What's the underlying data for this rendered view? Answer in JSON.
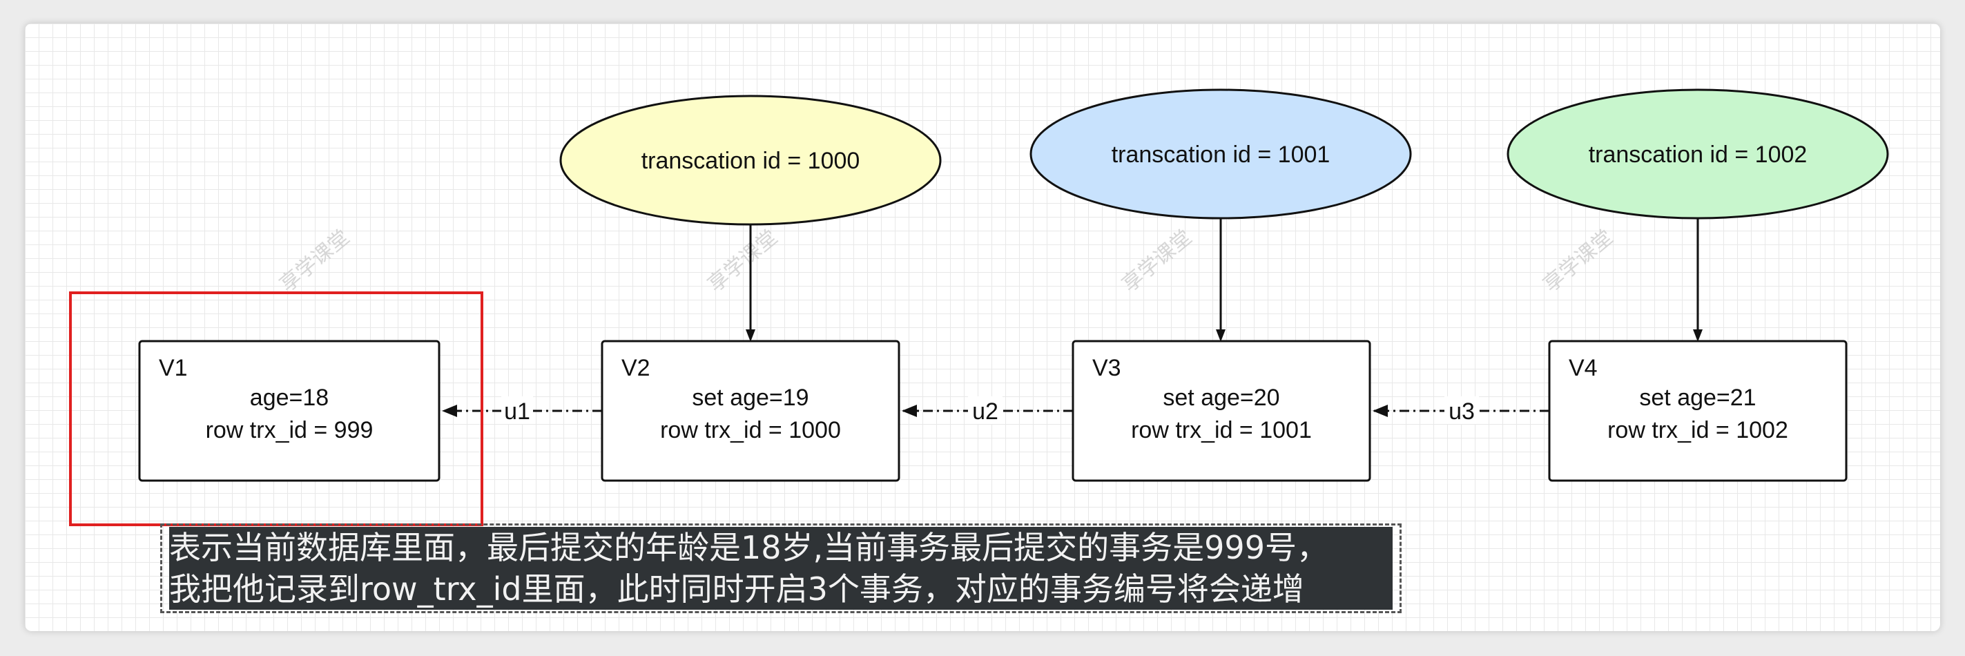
{
  "transactions": [
    {
      "label": "transcation id = 1000",
      "fill": "#fdfdc8"
    },
    {
      "label": "transcation id = 1001",
      "fill": "#c8e2fd"
    },
    {
      "label": "transcation id = 1002",
      "fill": "#c8f6cd"
    }
  ],
  "versions": [
    {
      "title": "V1",
      "line1": "age=18",
      "line2": "row trx_id = 999"
    },
    {
      "title": "V2",
      "line1": "set age=19",
      "line2": "row trx_id = 1000"
    },
    {
      "title": "V3",
      "line1": "set age=20",
      "line2": "row trx_id = 1001"
    },
    {
      "title": "V4",
      "line1": "set age=21",
      "line2": "row trx_id = 1002"
    }
  ],
  "undo_links": [
    "u1",
    "u2",
    "u3"
  ],
  "highlight_color": "#e02020",
  "caption": {
    "line1": "表示当前数据库里面，最后提交的年龄是18岁,当前事务最后提交的事务是999号，",
    "line2": "我把他记录到row_trx_id里面，此时同时开启3个事务，对应的事务编号将会递增"
  },
  "watermark": "享学课堂"
}
